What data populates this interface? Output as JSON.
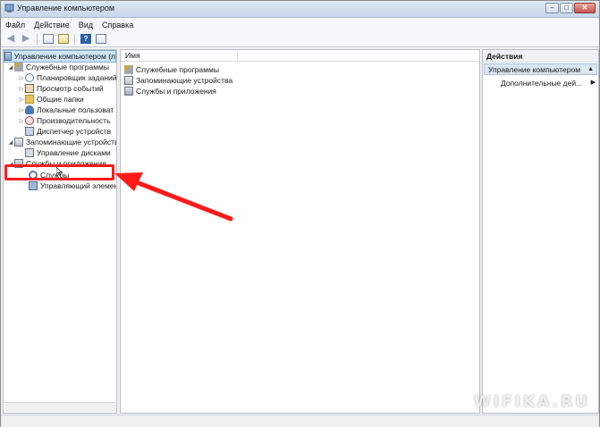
{
  "window": {
    "title": "Управление компьютером",
    "buttons": {
      "minimize": "–",
      "maximize": "□",
      "close": "✕"
    }
  },
  "menu": [
    "Файл",
    "Действие",
    "Вид",
    "Справка"
  ],
  "toolbar": {
    "icons": [
      "back-arrow",
      "forward-arrow",
      "show-hide-tree",
      "export-list",
      "help",
      "properties"
    ],
    "help_glyph": "?"
  },
  "tree": {
    "root": "Управление компьютером (л",
    "items": [
      {
        "label": "Служебные программы",
        "icon": "tools-icon",
        "expander": "◢"
      },
      {
        "label": "Планировщик заданий",
        "icon": "clock-icon",
        "expander": "▷"
      },
      {
        "label": "Просмотр событий",
        "icon": "event-log-icon",
        "expander": "▷"
      },
      {
        "label": "Общие папки",
        "icon": "shared-folder-icon",
        "expander": "▷"
      },
      {
        "label": "Локальные пользоват",
        "icon": "users-icon",
        "expander": "▷"
      },
      {
        "label": "Производительность",
        "icon": "performance-icon",
        "expander": "▷"
      },
      {
        "label": "Диспетчер устройств",
        "icon": "device-manager-icon",
        "expander": ""
      },
      {
        "label": "Запоминающие устройств",
        "icon": "storage-icon",
        "expander": "◢"
      },
      {
        "label": "Управление дисками",
        "icon": "disk-icon",
        "expander": ""
      },
      {
        "label": "Службы и приложения",
        "icon": "services-apps-icon",
        "expander": "◢"
      },
      {
        "label": "Службы",
        "icon": "services-icon",
        "expander": ""
      },
      {
        "label": "Управляющий элемен",
        "icon": "wmi-control-icon",
        "expander": ""
      }
    ]
  },
  "center": {
    "column_header": "Имя",
    "items": [
      "Служебные программы",
      "Запоминающие устройства",
      "Службы и приложения"
    ]
  },
  "actions": {
    "title": "Действия",
    "section": "Управление компьютером",
    "section_arrow": "▲",
    "more": "Дополнительные дей...",
    "more_arrow": "▶"
  },
  "watermark": "WIFIKA.RU",
  "colors": {
    "annotation_red": "#ff1a1a",
    "selection": "#cde3f7",
    "title_gradient_top": "#dfe9f5"
  }
}
